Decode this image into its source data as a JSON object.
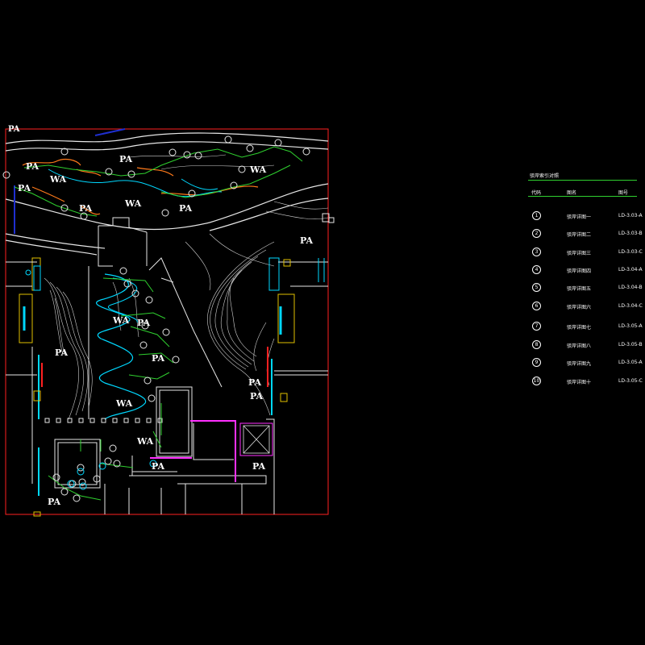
{
  "plan": {
    "labels": {
      "pa": "PA",
      "wa": "WA"
    },
    "colors": {
      "frame": "#ff2020",
      "contour": "#d8d8d8",
      "water_edge": "#00d8ff",
      "annotation": "#2fd02f",
      "rock": "#ff7a1a",
      "wall_magenta": "#ff30ff",
      "blue_line": "#1f2fd0",
      "column": "#e0c000"
    }
  },
  "legend": {
    "title": "驳岸索引对照",
    "headers": {
      "code": "代码",
      "name": "图名",
      "sheet": "图号"
    },
    "rows": [
      {
        "num": "1",
        "name": "驳岸详图一",
        "code": "LD-3.03-A"
      },
      {
        "num": "2",
        "name": "驳岸详图二",
        "code": "LD-3.03-B"
      },
      {
        "num": "3",
        "name": "驳岸详图三",
        "code": "LD-3.03-C"
      },
      {
        "num": "4",
        "name": "驳岸详图四",
        "code": "LD-3.04-A"
      },
      {
        "num": "5",
        "name": "驳岸详图五",
        "code": "LD-3.04-B"
      },
      {
        "num": "6",
        "name": "驳岸详图六",
        "code": "LD-3.04-C"
      },
      {
        "num": "7",
        "name": "驳岸详图七",
        "code": "LD-3.05-A"
      },
      {
        "num": "8",
        "name": "驳岸详图八",
        "code": "LD-3.05-B"
      },
      {
        "num": "9",
        "name": "驳岸详图九",
        "code": "LD-3.05-A"
      },
      {
        "num": "10",
        "name": "驳岸详图十",
        "code": "LD-3.05-C"
      }
    ]
  }
}
